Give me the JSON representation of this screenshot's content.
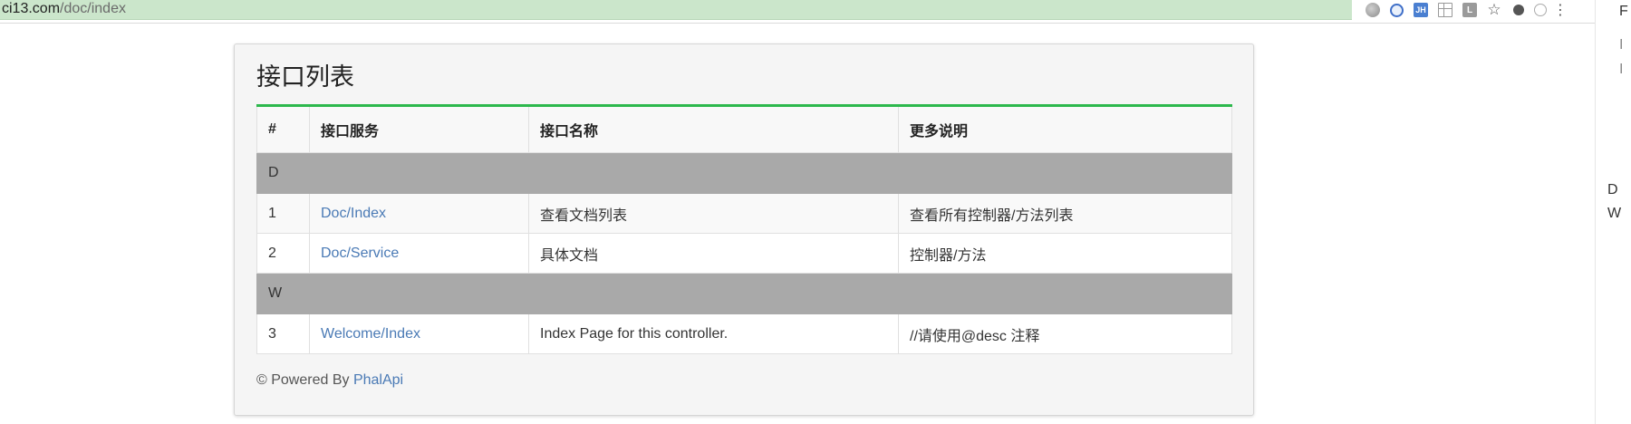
{
  "browser": {
    "url_host": "ci13.com",
    "url_path": "/doc/index",
    "extensions": [
      {
        "name": "globe-icon",
        "label": ""
      },
      {
        "name": "sync-icon",
        "label": ""
      },
      {
        "name": "jh-extension-icon",
        "label": "JH"
      },
      {
        "name": "reader-icon",
        "label": ""
      },
      {
        "name": "l-extension-icon",
        "label": "L"
      },
      {
        "name": "bookmark-star-icon",
        "label": "☆"
      },
      {
        "name": "dark-circle-icon",
        "label": ""
      },
      {
        "name": "ring-icon",
        "label": ""
      },
      {
        "name": "browser-menu-icon",
        "label": "⋮"
      }
    ]
  },
  "edge_text": {
    "top": "F",
    "item1": "D",
    "item2": "W"
  },
  "panel": {
    "title": "接口列表"
  },
  "table": {
    "headers": {
      "num": "#",
      "service": "接口服务",
      "name": "接口名称",
      "desc": "更多说明"
    },
    "groups": [
      {
        "letter": "D",
        "rows": [
          {
            "num": "1",
            "service": "Doc/Index",
            "name": "查看文档列表",
            "desc": "查看所有控制器/方法列表"
          },
          {
            "num": "2",
            "service": "Doc/Service",
            "name": "具体文档",
            "desc": "控制器/方法"
          }
        ]
      },
      {
        "letter": "W",
        "rows": [
          {
            "num": "3",
            "service": "Welcome/Index",
            "name": "Index Page for this controller.",
            "desc": "//请使用@desc 注释"
          }
        ]
      }
    ]
  },
  "footer": {
    "prefix": "© Powered By ",
    "link": "PhalApi"
  },
  "colors": {
    "accent_green": "#2db84d",
    "link_blue": "#4a7ab5",
    "group_gray": "#a9a9a9",
    "omnibox_green": "#cbe6cb"
  }
}
